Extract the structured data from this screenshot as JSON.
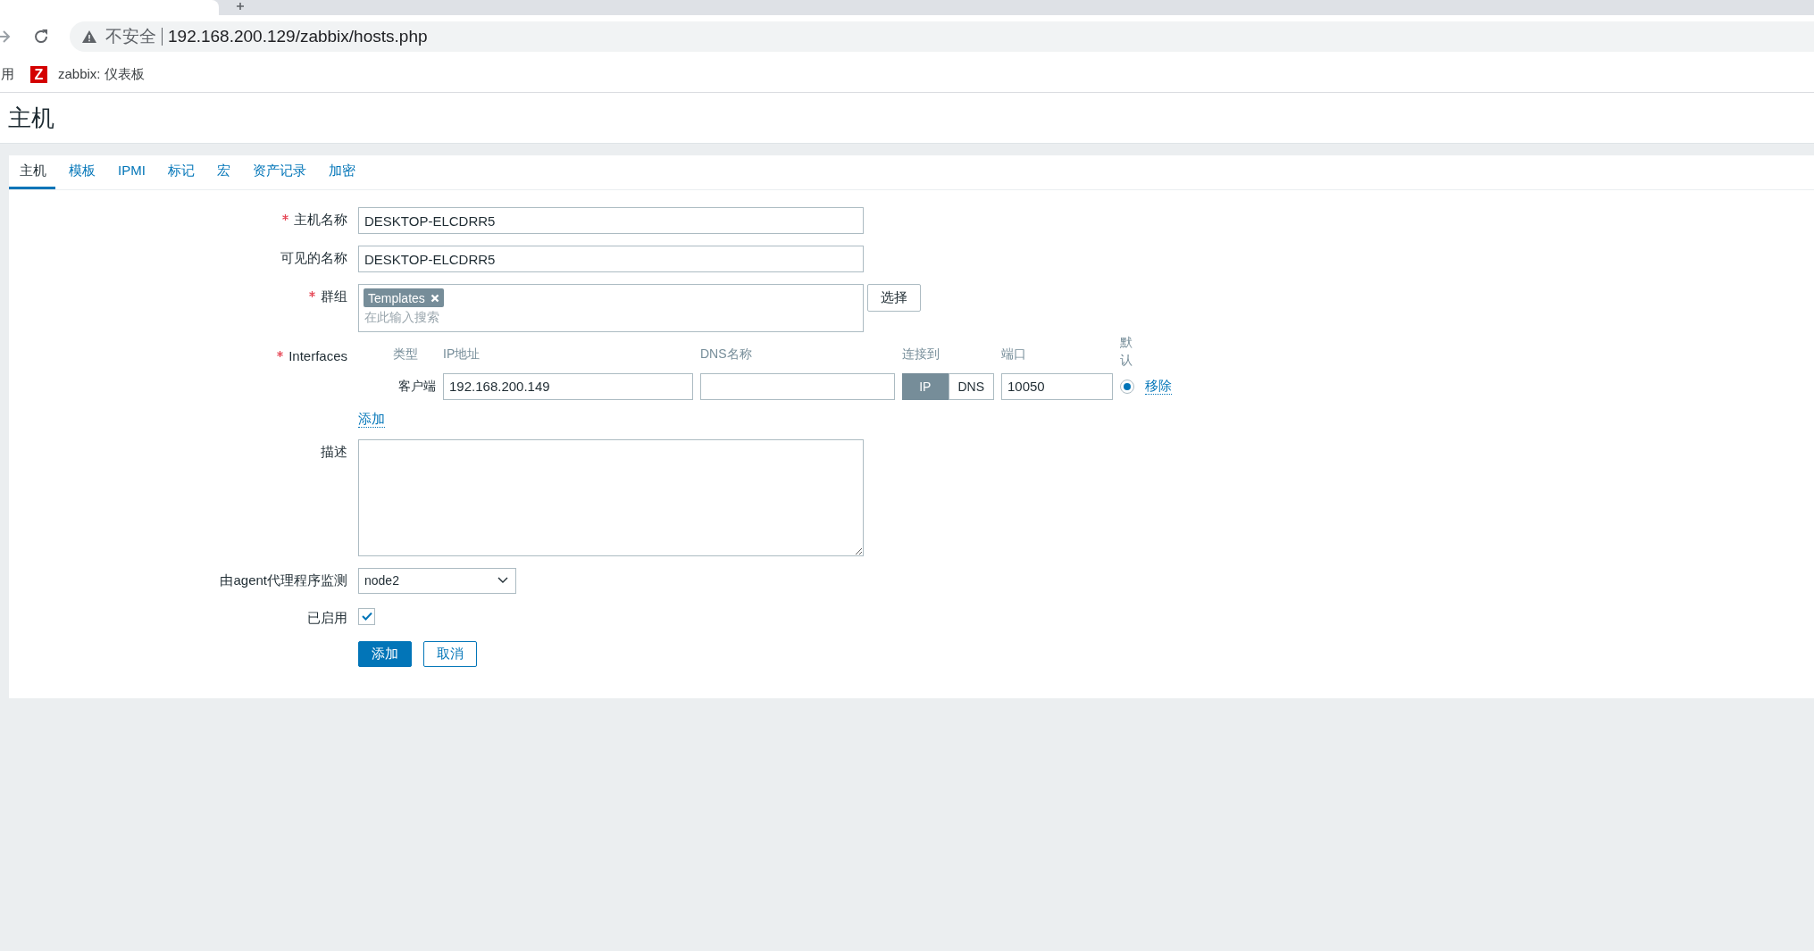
{
  "browser": {
    "security_label": "不安全",
    "url": "192.168.200.129/zabbix/hosts.php",
    "bookmarks": [
      {
        "kind": "plain",
        "label": "用"
      },
      {
        "kind": "logo",
        "logo_letter": "Z",
        "label": "zabbix: 仪表板"
      }
    ]
  },
  "page_title": "主机",
  "tabs": [
    {
      "label": "主机",
      "selected": true
    },
    {
      "label": "模板",
      "selected": false
    },
    {
      "label": "IPMI",
      "selected": false
    },
    {
      "label": "标记",
      "selected": false
    },
    {
      "label": "宏",
      "selected": false
    },
    {
      "label": "资产记录",
      "selected": false
    },
    {
      "label": "加密",
      "selected": false
    }
  ],
  "form": {
    "host_name": {
      "label": "主机名称",
      "required": true,
      "value": "DESKTOP-ELCDRR5"
    },
    "visible_name": {
      "label": "可见的名称",
      "required": false,
      "value": "DESKTOP-ELCDRR5"
    },
    "groups": {
      "label": "群组",
      "required": true,
      "tags": [
        "Templates"
      ],
      "placeholder": "在此输入搜索",
      "button": "选择"
    },
    "interfaces": {
      "label": "Interfaces",
      "required": true,
      "headers": [
        "类型",
        "IP地址",
        "DNS名称",
        "连接到",
        "端口",
        "默认"
      ],
      "rows": [
        {
          "type": "客户端",
          "ip": "192.168.200.149",
          "connect": [
            {
              "label": "IP",
              "selected": true
            },
            {
              "label": "DNS",
              "selected": false
            }
          ],
          "port": "10050",
          "default": true,
          "remove": "移除"
        }
      ],
      "add_link": "添加"
    },
    "description": {
      "label": "描述"
    },
    "proxy": {
      "label": "由agent代理程序监测",
      "value": "node2"
    },
    "enabled": {
      "label": "已启用",
      "checked": true
    },
    "buttons": [
      {
        "label": "添加",
        "kind": "primary"
      },
      {
        "label": "取消",
        "kind": "secondary"
      }
    ]
  }
}
